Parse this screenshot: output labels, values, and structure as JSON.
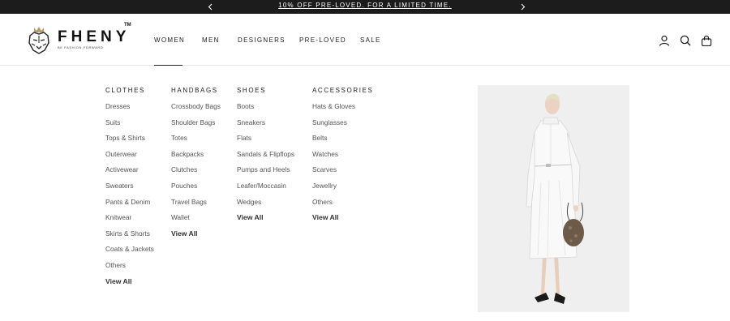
{
  "announcement": {
    "text": "10% OFF PRE-LOVED. FOR A LIMITED TIME."
  },
  "brand": {
    "name": "FHENY",
    "tm": "TM",
    "tagline": "BE FASHION FORWARD"
  },
  "nav": {
    "items": [
      "WOMEN",
      "MEN",
      "DESIGNERS",
      "PRE-LOVED",
      "SALE"
    ],
    "active": "WOMEN"
  },
  "header_icons": [
    "account-icon",
    "search-icon",
    "bag-icon"
  ],
  "menu": {
    "columns": [
      {
        "title": "CLOTHES",
        "items": [
          "Dresses",
          "Suits",
          "Tops & Shirts",
          "Outerwear",
          "Activewear",
          "Sweaters",
          "Pants & Denim",
          "Knitwear",
          "Skirts & Shorts",
          "Coats & Jackets",
          "Others"
        ],
        "view_all": "View All"
      },
      {
        "title": "HANDBAGS",
        "items": [
          "Crossbody Bags",
          "Shoulder Bags",
          "Totes",
          "Backpacks",
          "Clutches",
          "Pouches",
          "Travel Bags",
          "Wallet"
        ],
        "view_all": "View All"
      },
      {
        "title": "SHOES",
        "items": [
          "Boots",
          "Sneakers",
          "Flats",
          "Sandals & Flipflops",
          "Pumps and Heels",
          "Leafer/Moccasin",
          "Wedges"
        ],
        "view_all": "View All"
      },
      {
        "title": "ACCESSORIES",
        "items": [
          "Hats & Gloves",
          "Sunglasses",
          "Belts",
          "Watches",
          "Scarves",
          "Jewellry",
          "Others"
        ],
        "view_all": "View All"
      }
    ]
  },
  "colors": {
    "bar": "#1c1c1c",
    "text": "#222222",
    "muted": "#555555",
    "promo_bg": "#efeff0"
  }
}
